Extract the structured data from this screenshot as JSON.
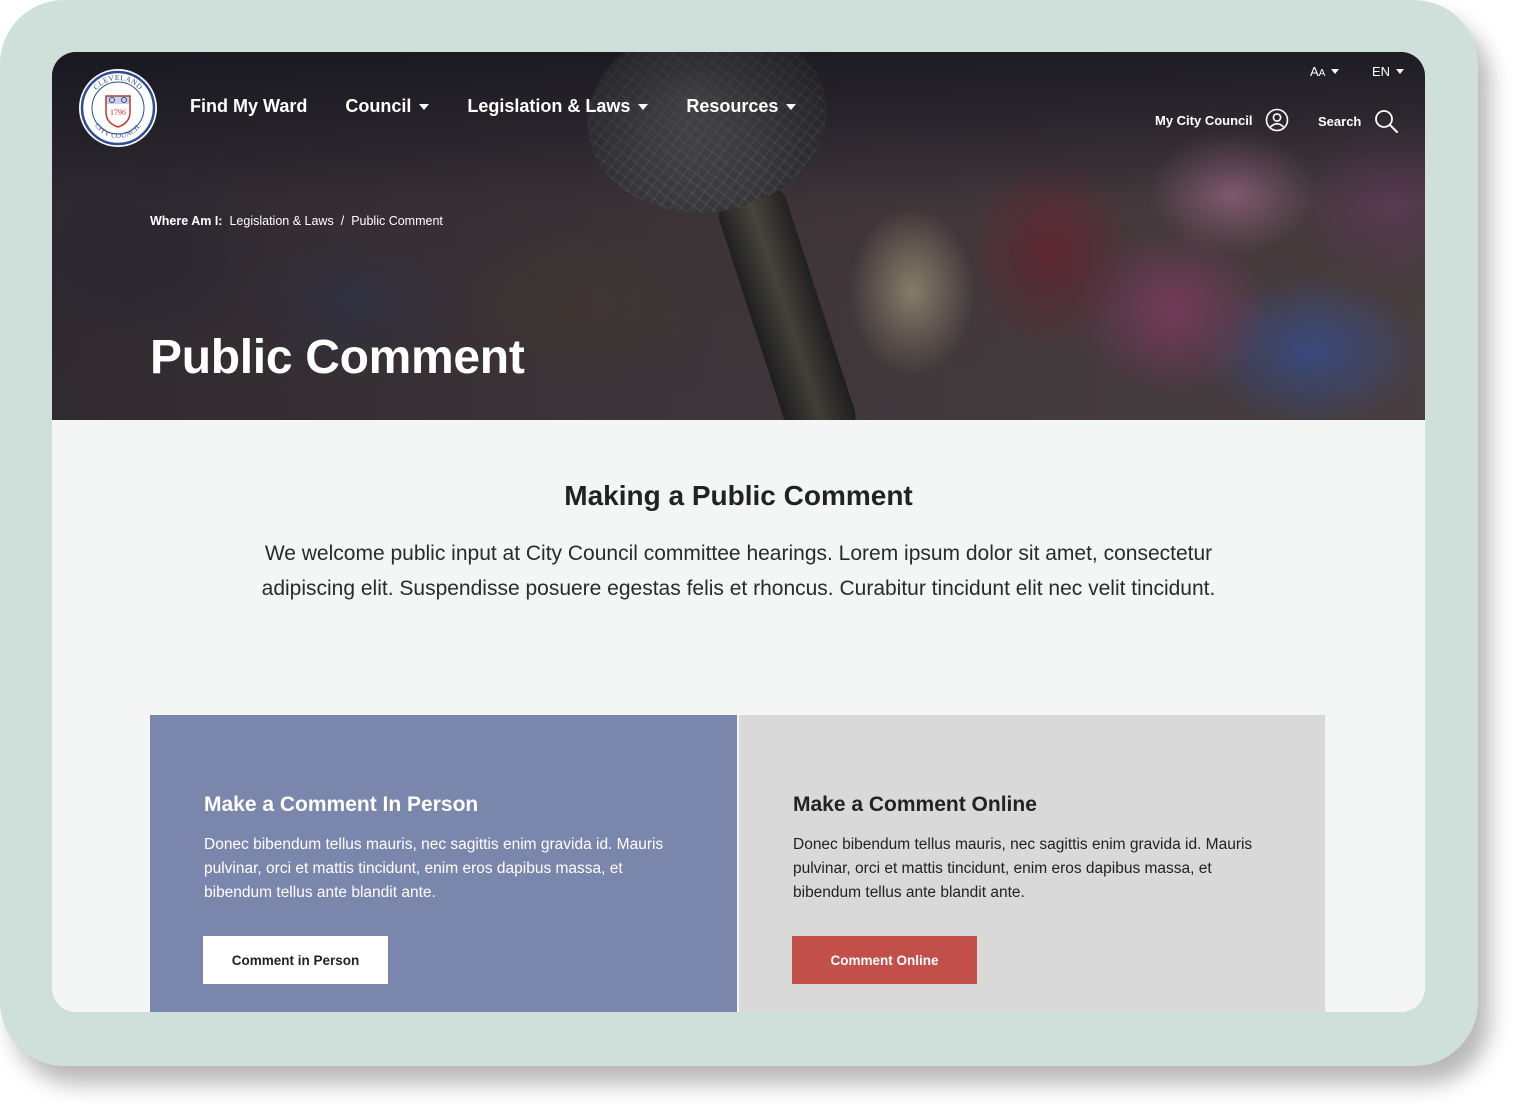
{
  "logo": {
    "top_text": "CLEVELAND",
    "year": "1796",
    "bottom_text": "CITY COUNCIL"
  },
  "nav": {
    "items": [
      {
        "label": "Find My Ward",
        "has_dropdown": false
      },
      {
        "label": "Council",
        "has_dropdown": true
      },
      {
        "label": "Legislation & Laws",
        "has_dropdown": true
      },
      {
        "label": "Resources",
        "has_dropdown": true
      }
    ]
  },
  "utility": {
    "text_size_label_big": "A",
    "text_size_label_small": "A",
    "language": "EN",
    "my_council": "My City Council",
    "search": "Search"
  },
  "breadcrumb": {
    "prefix": "Where Am I:",
    "items": [
      "Legislation & Laws",
      "Public Comment"
    ],
    "separator": "/"
  },
  "hero": {
    "title": "Public Comment"
  },
  "intro": {
    "title": "Making a Public Comment",
    "text": "We welcome public input at City Council committee hearings. Lorem ipsum dolor sit amet, consectetur adipiscing elit. Suspendisse posuere egestas felis et rhoncus. Curabitur tincidunt elit nec velit tincidunt."
  },
  "cards": [
    {
      "title": "Make a Comment In Person",
      "text": "Donec bibendum tellus mauris, nec sagittis enim gravida id. Mauris pulvinar, orci et mattis tincidunt, enim eros dapibus massa, et bibendum tellus ante blandit ante.",
      "button": "Comment in Person",
      "bg": "#7a86ac"
    },
    {
      "title": "Make a Comment Online",
      "text": "Donec bibendum tellus mauris, nec sagittis enim gravida id. Mauris pulvinar, orci et mattis tincidunt, enim eros dapibus massa, et bibendum tellus ante blandit ante.",
      "button": "Comment Online",
      "bg": "#d8d9d8"
    }
  ],
  "colors": {
    "accent_red": "#c24f49",
    "card_blue": "#7a86ac",
    "card_gray": "#d8d9d8",
    "device_frame": "#cfe0da"
  },
  "icons": {
    "account": "user-circle-icon",
    "search": "magnifier-icon",
    "dropdown": "caret-down-icon"
  }
}
